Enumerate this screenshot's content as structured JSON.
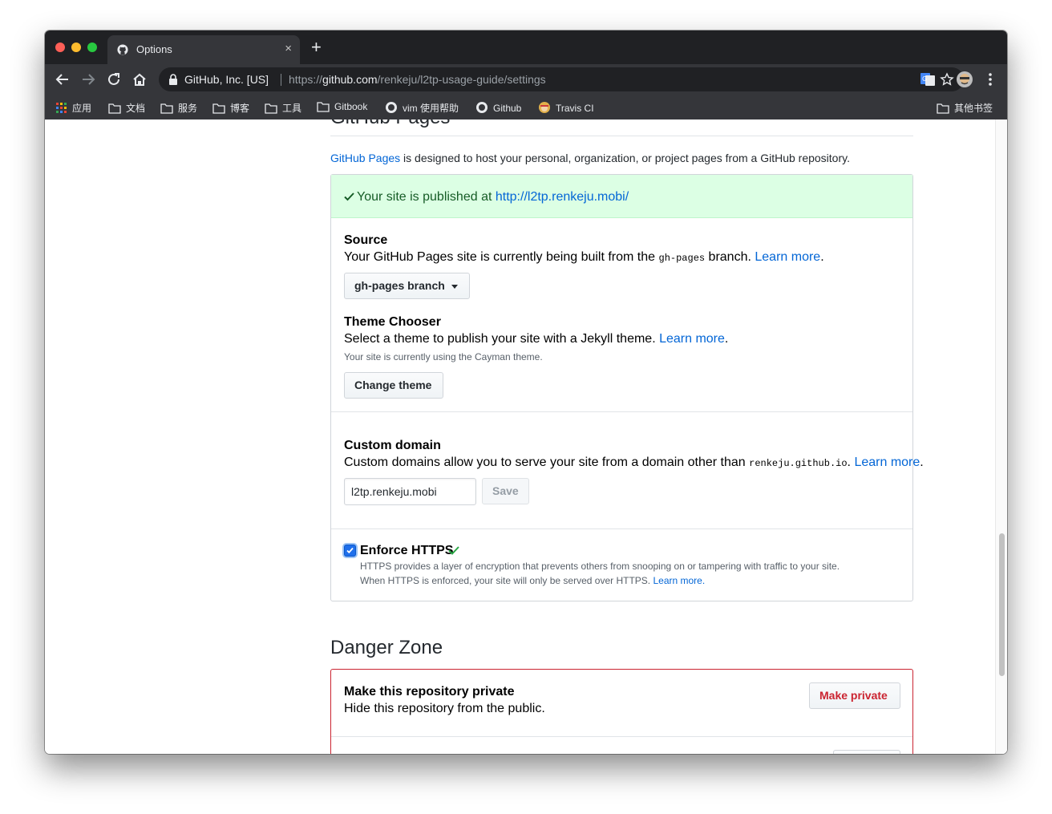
{
  "browser": {
    "tab_title": "Options",
    "tab_close": "×",
    "new_tab": "+",
    "identity": "GitHub, Inc. [US]",
    "url_scheme": "https://",
    "url_host": "github.com",
    "url_path": "/renkeju/l2tp-usage-guide/settings",
    "bookmarks": [
      {
        "label": "应用"
      },
      {
        "label": "文档"
      },
      {
        "label": "服务"
      },
      {
        "label": "博客"
      },
      {
        "label": "工具"
      },
      {
        "label": "Gitbook"
      },
      {
        "label": "vim 使用帮助"
      },
      {
        "label": "Github"
      },
      {
        "label": "Travis CI"
      }
    ],
    "other_bookmarks": "其他书签"
  },
  "pages": {
    "heading": "GitHub Pages",
    "intro_link": "GitHub Pages",
    "intro_rest": " is designed to host your personal, organization, or project pages from a GitHub repository.",
    "published_text": "Your site is published at ",
    "published_url": "http://l2tp.renkeju.mobi/",
    "source_title": "Source",
    "source_desc_1": "Your GitHub Pages site is currently being built from the ",
    "source_branch_code": "gh-pages",
    "source_desc_2": " branch. ",
    "source_learn": "Learn more",
    "period": ".",
    "branch_button": "gh-pages branch",
    "theme_title": "Theme Chooser",
    "theme_desc": "Select a theme to publish your site with a Jekyll theme. ",
    "theme_learn": "Learn more",
    "theme_note": "Your site is currently using the Cayman theme.",
    "change_theme": "Change theme",
    "domain_title": "Custom domain",
    "domain_desc": "Custom domains allow you to serve your site from a domain other than ",
    "domain_code": "renkeju.github.io",
    "domain_learn": "Learn more",
    "domain_value": "l2tp.renkeju.mobi",
    "save_button": "Save",
    "https_title": "Enforce HTTPS",
    "https_desc_1": "HTTPS provides a layer of encryption that prevents others from snooping on or tampering with traffic to your site.",
    "https_desc_2": "When HTTPS is enforced, your site will only be served over HTTPS. ",
    "https_learn": "Learn more."
  },
  "danger": {
    "heading": "Danger Zone",
    "private_title": "Make this repository private",
    "private_desc": "Hide this repository from the public.",
    "private_button": "Make private"
  },
  "colors": {
    "chrome_dark": "#202124",
    "chrome_toolbar": "#35363a",
    "link": "#0366d6",
    "success_bg": "#dcffe4",
    "success_text": "#22863a",
    "danger": "#cb2431"
  }
}
